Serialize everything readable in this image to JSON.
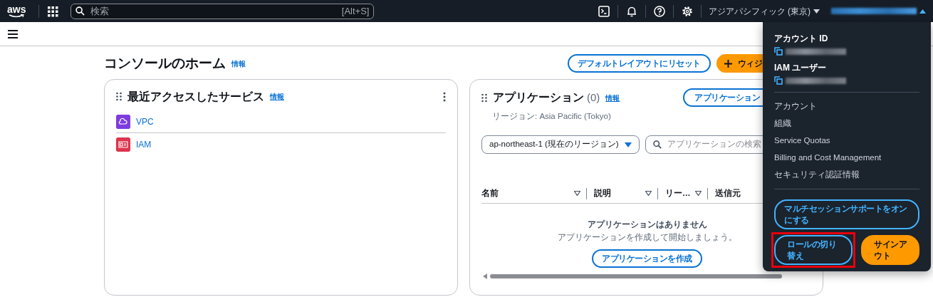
{
  "top_nav": {
    "logo": "aws",
    "search": {
      "placeholder": "検索",
      "shortcut": "[Alt+S]"
    },
    "region": "アジアパシフィック (東京)",
    "account_menu_expanded": true
  },
  "page": {
    "title": "コンソールのホーム",
    "info": "情報",
    "buttons": [
      {
        "label": "デフォルトレイアウトにリセット",
        "kind": "outline"
      },
      {
        "label": "ウィジ",
        "kind": "primary"
      }
    ]
  },
  "recent_services": {
    "title": "最近アクセスしたサービス",
    "info": "情報",
    "items": [
      {
        "label": "VPC",
        "color": "#7d3ce0"
      },
      {
        "label": "IAM",
        "color": "#dd344c"
      }
    ]
  },
  "applications": {
    "title": "アプリケーション",
    "count": "(0)",
    "info": "情報",
    "region_line": "リージョン: Asia Pacific (Tokyo)",
    "create_button": "アプリケーション",
    "region_select": "ap-northeast-1 (現在のリージョン)",
    "search_placeholder": "アプリケーションの検索",
    "columns": [
      "名前",
      "説明",
      "リー…",
      "送信元"
    ],
    "empty_title": "アプリケーションはありません",
    "empty_text": "アプリケーションを作成して開始しましょう。",
    "empty_button": "アプリケーションを作成"
  },
  "account_menu": {
    "account_id_label": "アカウント ID",
    "iam_user_label": "IAM ユーザー",
    "links": [
      "アカウント",
      "組織",
      "Service Quotas",
      "Billing and Cost Management",
      "セキュリティ認証情報"
    ],
    "multi_session_button": "マルチセッションサポートをオンにする",
    "switch_role_button": "ロールの切り替え",
    "sign_out_button": "サインアウト",
    "switch_role_highlighted": true
  }
}
